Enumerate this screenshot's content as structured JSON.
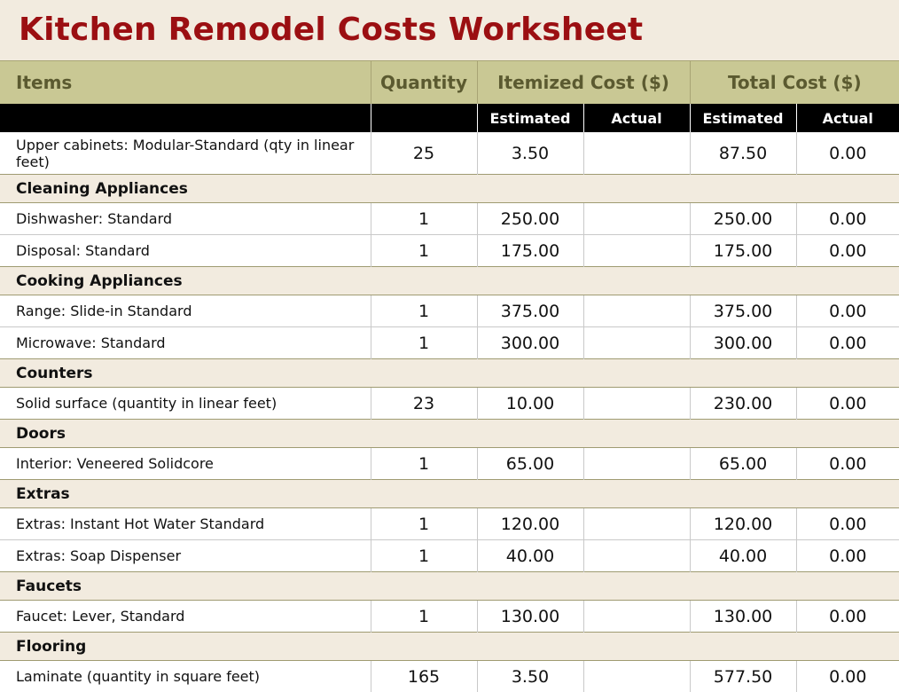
{
  "title": "Kitchen Remodel Costs Worksheet",
  "headers": {
    "items": "Items",
    "quantity": "Quantity",
    "itemized_cost": "Itemized Cost ($)",
    "total_cost": "Total Cost ($)",
    "estimated": "Estimated",
    "actual": "Actual"
  },
  "rows": [
    {
      "type": "item",
      "item": "Upper cabinets: Modular-Standard (qty in linear feet)",
      "qty": "25",
      "est": "3.50",
      "act": "",
      "total_est": "87.50",
      "total_act": "0.00"
    },
    {
      "type": "category",
      "label": "Cleaning Appliances"
    },
    {
      "type": "item",
      "item": "Dishwasher: Standard",
      "qty": "1",
      "est": "250.00",
      "act": "",
      "total_est": "250.00",
      "total_act": "0.00"
    },
    {
      "type": "item",
      "item": "Disposal: Standard",
      "qty": "1",
      "est": "175.00",
      "act": "",
      "total_est": "175.00",
      "total_act": "0.00"
    },
    {
      "type": "category",
      "label": "Cooking Appliances"
    },
    {
      "type": "item",
      "item": "Range: Slide-in Standard",
      "qty": "1",
      "est": "375.00",
      "act": "",
      "total_est": "375.00",
      "total_act": "0.00"
    },
    {
      "type": "item",
      "item": "Microwave: Standard",
      "qty": "1",
      "est": "300.00",
      "act": "",
      "total_est": "300.00",
      "total_act": "0.00"
    },
    {
      "type": "category",
      "label": "Counters"
    },
    {
      "type": "item",
      "item": "Solid surface (quantity in linear feet)",
      "qty": "23",
      "est": "10.00",
      "act": "",
      "total_est": "230.00",
      "total_act": "0.00"
    },
    {
      "type": "category",
      "label": "Doors"
    },
    {
      "type": "item",
      "item": "Interior: Veneered Solidcore",
      "qty": "1",
      "est": "65.00",
      "act": "",
      "total_est": "65.00",
      "total_act": "0.00"
    },
    {
      "type": "category",
      "label": "Extras"
    },
    {
      "type": "item",
      "item": "Extras: Instant Hot Water Standard",
      "qty": "1",
      "est": "120.00",
      "act": "",
      "total_est": "120.00",
      "total_act": "0.00"
    },
    {
      "type": "item",
      "item": "Extras: Soap Dispenser",
      "qty": "1",
      "est": "40.00",
      "act": "",
      "total_est": "40.00",
      "total_act": "0.00"
    },
    {
      "type": "category",
      "label": "Faucets"
    },
    {
      "type": "item",
      "item": "Faucet: Lever, Standard",
      "qty": "1",
      "est": "130.00",
      "act": "",
      "total_est": "130.00",
      "total_act": "0.00"
    },
    {
      "type": "category",
      "label": "Flooring"
    },
    {
      "type": "item",
      "item": "Laminate (quantity in square feet)",
      "qty": "165",
      "est": "3.50",
      "act": "",
      "total_est": "577.50",
      "total_act": "0.00"
    }
  ]
}
